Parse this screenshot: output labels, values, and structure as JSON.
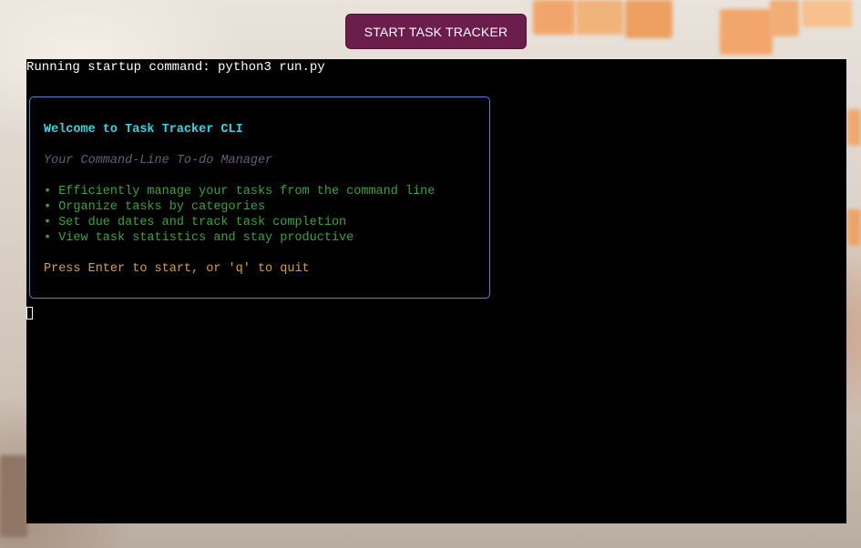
{
  "header": {
    "start_button_label": "START TASK TRACKER",
    "start_button_color": "#6b1d4b"
  },
  "terminal": {
    "startup_line": "Running startup command: python3 run.py",
    "welcome": {
      "title": "Welcome to Task Tracker CLI",
      "tagline": "Your Command-Line To-do Manager",
      "features": [
        "• Efficiently manage your tasks from the command line",
        "• Organize tasks by categories",
        "• Set due dates and track task completion",
        "• View task statistics and stay productive"
      ],
      "prompt": "Press Enter to start, or 'q' to quit"
    },
    "colors": {
      "background": "#000000",
      "title": "#33d6e6",
      "tagline": "#6a5a78",
      "features": "#3aa33a",
      "prompt": "#d7a13a",
      "border": "#5b7fd8"
    }
  }
}
